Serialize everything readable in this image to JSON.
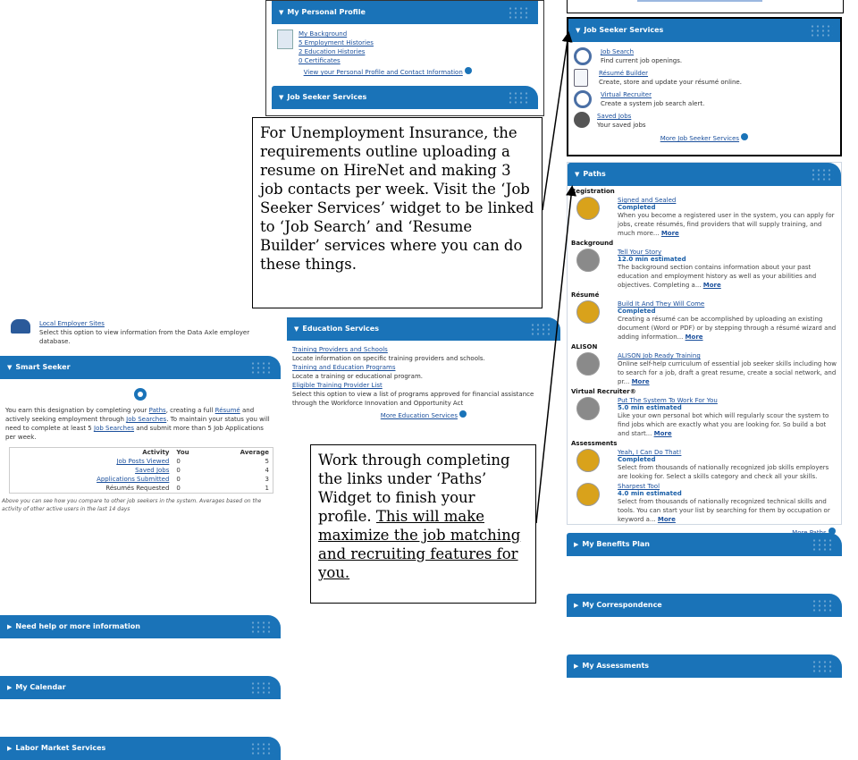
{
  "profile": {
    "title": "My Personal Profile",
    "links": [
      "My Background",
      "5 Employment Histories",
      "2 Education Histories",
      "0 Certificates"
    ],
    "view_link": "View your Personal Profile and Contact Information",
    "jss_title": "Job Seeker Services"
  },
  "jss": {
    "title": "Job Seeker Services",
    "items": [
      {
        "label": "Job Search",
        "desc": "Find current job openings."
      },
      {
        "label": "Résumé Builder",
        "desc": "Create, store and update your résumé online."
      },
      {
        "label": "Virtual Recruiter",
        "desc": "Create a system job search alert."
      },
      {
        "label": "Saved Jobs",
        "desc": "Your saved jobs"
      }
    ],
    "more": "More Job Seeker Services"
  },
  "callout1": "For Unemployment Insurance, the requirements outline uploading a resume on HireNet and making 3 job contacts per week. Visit the ‘Job Seeker Services’ widget to be linked to ‘Job Search’ and ‘Resume Builder’ services where you can do these things.",
  "callout2": {
    "text": "Work through completing the links under ‘Paths’ Widget to finish your profile. ",
    "underlined": "This will make maximize the job matching and recruiting features for you."
  },
  "paths": {
    "title": "Paths",
    "sections": [
      {
        "name": "Registration",
        "link": "Signed and Sealed",
        "status": "Completed",
        "desc": "When you become a registered user in the system, you can apply for jobs, create résumés, find providers that will supply training, and much more...",
        "more": "More",
        "color": "#d9a21b"
      },
      {
        "name": "Background",
        "link": "Tell Your Story",
        "status": "12.0 min estimated",
        "desc": "The background section contains information about your past education and employment history as well as your abilities and objectives. Completing a...",
        "more": "More",
        "color": "#8a8a8a"
      },
      {
        "name": "Résumé",
        "link": "Build It And They Will Come",
        "status": "Completed",
        "desc": "Creating a résumé can be accomplished by uploading an existing document (Word or PDF) or by stepping through a résumé wizard and adding information...",
        "more": "More",
        "color": "#d9a21b"
      },
      {
        "name": "ALISON",
        "link": "ALISON Job Ready Training",
        "status": "",
        "desc": "Online self-help curriculum of essential job seeker skills including how to search for a job, draft a great resume, create a social network, and pr...",
        "more": "More",
        "color": "#8a8a8a"
      },
      {
        "name": "Virtual Recruiter®",
        "link": "Put The System To Work For You",
        "status": "5.0 min estimated",
        "desc": "Like your own personal bot which will regularly scour the system to find jobs which are exactly what you are looking for. So build a bot and start...",
        "more": "More",
        "color": "#8a8a8a"
      },
      {
        "name": "Assessments",
        "link": "Yeah, I Can Do That!",
        "status": "Completed",
        "desc": "Select from thousands of nationally recognized job skills employers are looking for. Select a skills category and check all your skills.",
        "more": "",
        "color": "#d9a21b"
      },
      {
        "name": "",
        "link": "Sharpest Tool",
        "status": "4.0 min estimated",
        "desc": "Select from thousands of nationally recognized technical skills and tools. You can start your list by searching for them by occupation or keyword a...",
        "more": "More",
        "color": "#d9a21b"
      }
    ],
    "more_paths": "More Paths"
  },
  "right_bars": [
    "My Benefits Plan",
    "My Correspondence",
    "My Assessments"
  ],
  "local": {
    "link": "Local Employer Sites",
    "desc": "Select this option to view information from the Data Axle employer database."
  },
  "smart": {
    "title": "Smart Seeker",
    "p1": "You earn this designation by completing your",
    "paths": "Paths",
    "p2": ", creating a full",
    "resume": "Résumé",
    "p3": "and actively seeking employment through",
    "jobsearches": "Job Searches",
    "p4": ". To maintain your status you will need to complete at least 5",
    "jobsearches2": "Job Searches",
    "p5": "and submit more than 5 Job Applications per week.",
    "headers": [
      "Activity",
      "You",
      "Average"
    ],
    "rows": [
      {
        "activity": "Job Posts Viewed",
        "you": "0",
        "avg": "5"
      },
      {
        "activity": "Saved Jobs",
        "you": "0",
        "avg": "4"
      },
      {
        "activity": "Applications Submitted",
        "you": "0",
        "avg": "3"
      },
      {
        "activity": "Résumés Requested",
        "you": "0",
        "avg": "1"
      }
    ],
    "footnote": "Above you can see how you compare to other job seekers in the system. Averages based on the activity of other active users in the last 14 days"
  },
  "left_bars": [
    "Need help or more information",
    "My Calendar",
    "Labor Market Services"
  ],
  "edu": {
    "title": "Education Services",
    "items": [
      {
        "label": "Training Providers and Schools",
        "desc": "Locate information on specific training providers and schools."
      },
      {
        "label": "Training and Education Programs",
        "desc": "Locate a training or educational program."
      },
      {
        "label": "Eligible Training Provider List",
        "desc": "Select this option to view a list of programs approved for financial assistance through the Workforce Innovation and Opportunity Act"
      }
    ],
    "more": "More Education Services"
  }
}
